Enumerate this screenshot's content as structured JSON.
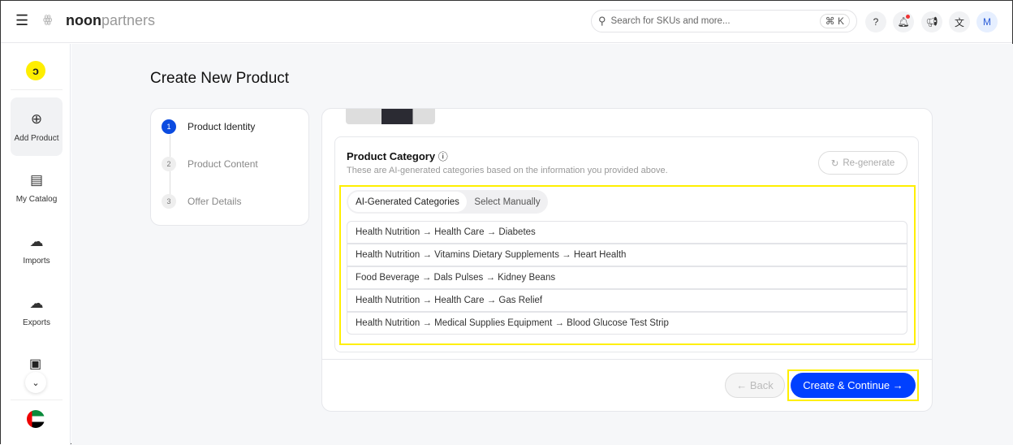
{
  "header": {
    "brand_bold": "noon",
    "brand_light": "partners",
    "search_placeholder": "Search for SKUs and more...",
    "shortcut": "⌘ K",
    "avatar": "M"
  },
  "sidebar": {
    "items": [
      {
        "label": "Add Product"
      },
      {
        "label": "My Catalog"
      },
      {
        "label": "Imports"
      },
      {
        "label": "Exports"
      }
    ]
  },
  "page": {
    "title": "Create New Product"
  },
  "steps": [
    {
      "num": "1",
      "label": "Product Identity"
    },
    {
      "num": "2",
      "label": "Product Content"
    },
    {
      "num": "3",
      "label": "Offer Details"
    }
  ],
  "category": {
    "title": "Product Category",
    "subtitle": "These are AI-generated categories based on the information you provided above.",
    "regenerate": "Re-generate",
    "tabs": [
      "AI-Generated Categories",
      "Select Manually"
    ],
    "rows": [
      "Health Nutrition → Health Care → Diabetes",
      "Health Nutrition → Vitamins Dietary Supplements → Heart Health",
      "Food Beverage → Dals Pulses → Kidney Beans",
      "Health Nutrition → Health Care → Gas Relief",
      "Health Nutrition → Medical Supplies Equipment → Blood Glucose Test Strip"
    ]
  },
  "footer": {
    "back": "← Back",
    "create": "Create & Continue →"
  },
  "colors": {
    "accent": "#0040ff",
    "highlight": "#ffef00",
    "noon_yellow": "#feee00"
  }
}
